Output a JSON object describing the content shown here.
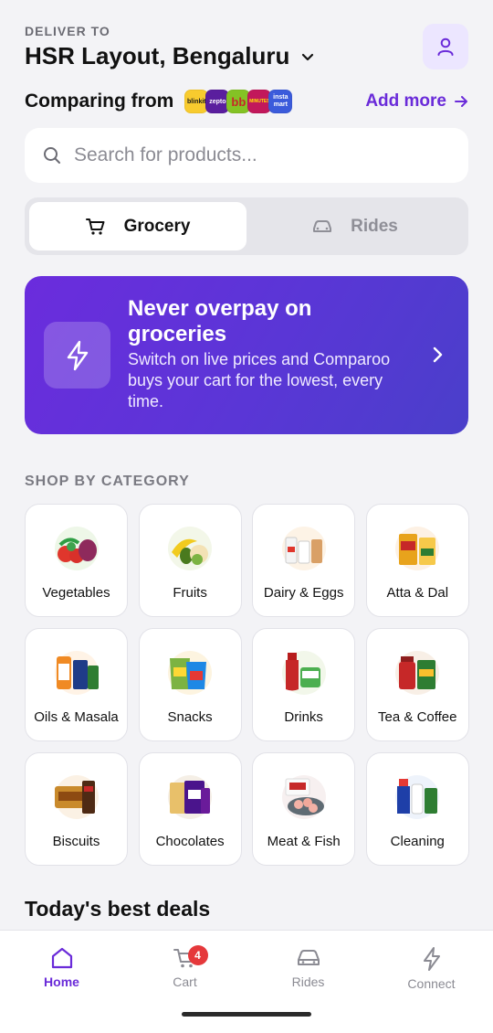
{
  "header": {
    "deliver_label": "DELIVER TO",
    "location": "HSR Layout, Bengaluru"
  },
  "compare": {
    "label": "Comparing from",
    "logos": [
      {
        "text": "blinkit",
        "bg": "#f8cb2e",
        "fg": "#1a1a1a"
      },
      {
        "text": "zepto",
        "bg": "#5a1e9e",
        "fg": "#ffffff"
      },
      {
        "text": "bb",
        "bg": "#84c225",
        "fg": "#c62828"
      },
      {
        "text": "MINUTES",
        "bg": "#c2185b",
        "fg": "#ffe600"
      },
      {
        "text": "insta mart",
        "bg": "#3b5bdb",
        "fg": "#ffffff"
      }
    ],
    "add_more": "Add more"
  },
  "search": {
    "placeholder": "Search for products..."
  },
  "tabs": [
    {
      "label": "Grocery",
      "active": true
    },
    {
      "label": "Rides",
      "active": false
    }
  ],
  "banner": {
    "title": "Never overpay on groceries",
    "subtitle": "Switch on live prices and Comparoo buys your cart for the lowest, every time."
  },
  "section_title": "SHOP BY CATEGORY",
  "categories": [
    {
      "label": "Vegetables"
    },
    {
      "label": "Fruits"
    },
    {
      "label": "Dairy & Eggs"
    },
    {
      "label": "Atta & Dal"
    },
    {
      "label": "Oils & Masala"
    },
    {
      "label": "Snacks"
    },
    {
      "label": "Drinks"
    },
    {
      "label": "Tea & Coffee"
    },
    {
      "label": "Biscuits"
    },
    {
      "label": "Chocolates"
    },
    {
      "label": "Meat & Fish"
    },
    {
      "label": "Cleaning"
    }
  ],
  "deals_title": "Today's best deals",
  "nav": [
    {
      "label": "Home",
      "icon": "home-icon",
      "active": true
    },
    {
      "label": "Cart",
      "icon": "cart-icon",
      "badge": "4"
    },
    {
      "label": "Rides",
      "icon": "car-icon"
    },
    {
      "label": "Connect",
      "icon": "bolt-icon"
    }
  ],
  "colors": {
    "accent": "#6a2bd9",
    "background": "#f3f3f6",
    "badge": "#e5383b"
  }
}
